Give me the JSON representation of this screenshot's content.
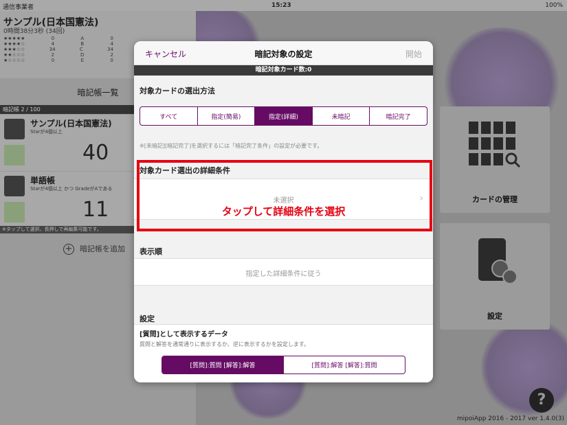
{
  "status_bar": {
    "carrier": "通信事業者",
    "time": "15:23",
    "battery": "100%"
  },
  "background": {
    "left_panel": {
      "deck_title": "サンプル(日本国憲法)",
      "deck_stats": "0時間38分3秒 (34回)",
      "star_rows": [
        {
          "stars": "★★★★★",
          "count": "0",
          "grade": "A",
          "gcount": "0"
        },
        {
          "stars": "★★★★☆",
          "count": "4",
          "grade": "B",
          "gcount": "4"
        },
        {
          "stars": "★★★☆☆",
          "count": "34",
          "grade": "C",
          "gcount": "34"
        },
        {
          "stars": "★★☆☆☆",
          "count": "2",
          "grade": "D",
          "gcount": "2"
        },
        {
          "stars": "★☆☆☆☆",
          "count": "0",
          "grade": "E",
          "gcount": "0"
        }
      ],
      "list_title": "暗記帳一覧",
      "list_count": "暗記帳 2 / 100",
      "books": [
        {
          "name": "サンプル(日本国憲法)",
          "condition": "Starが4個以上",
          "count": "40"
        },
        {
          "name": "単語帳",
          "condition": "Starが4個以上 かつ GradeがAである",
          "count": "11"
        }
      ],
      "hint": "※タップして選択、長押しで再編集可能です。",
      "add_label": "暗記帳を追加"
    },
    "right_tiles": {
      "card_manage": "カードの管理",
      "settings": "設定"
    },
    "help_icon": "?",
    "version": "mipoiApp 2016 - 2017 ver 1.4.0(3)"
  },
  "modal": {
    "cancel": "キャンセル",
    "title": "暗記対象の設定",
    "start": "開始",
    "target_count": "暗記対象カード数:0",
    "selection_header": "対象カードの選出方法",
    "selection_options": [
      "すべて",
      "指定(簡易)",
      "指定(詳細)",
      "未暗記",
      "暗記完了"
    ],
    "selection_selected": "指定(詳細)",
    "selection_note": "※[未暗記][暗記完了]を選択するには「暗記完了条件」の設定が必要です。",
    "detail_header": "対象カード選出の詳細条件",
    "detail_value": "未選択",
    "callout": "タップして詳細条件を選択",
    "order_header": "表示順",
    "order_value": "指定した詳細条件に従う",
    "settings_header": "設定",
    "question_data_label": "[質問]として表示するデータ",
    "question_data_desc": "質問と解答を通常通りに表示するか、逆に表示するかを設定します。",
    "question_options": [
      "[質問]:質問 [解答]:解答",
      "[質問]:解答 [解答]:質問"
    ],
    "question_selected": "[質問]:質問 [解答]:解答"
  },
  "colors": {
    "accent": "#650b64",
    "highlight": "#e60012"
  }
}
